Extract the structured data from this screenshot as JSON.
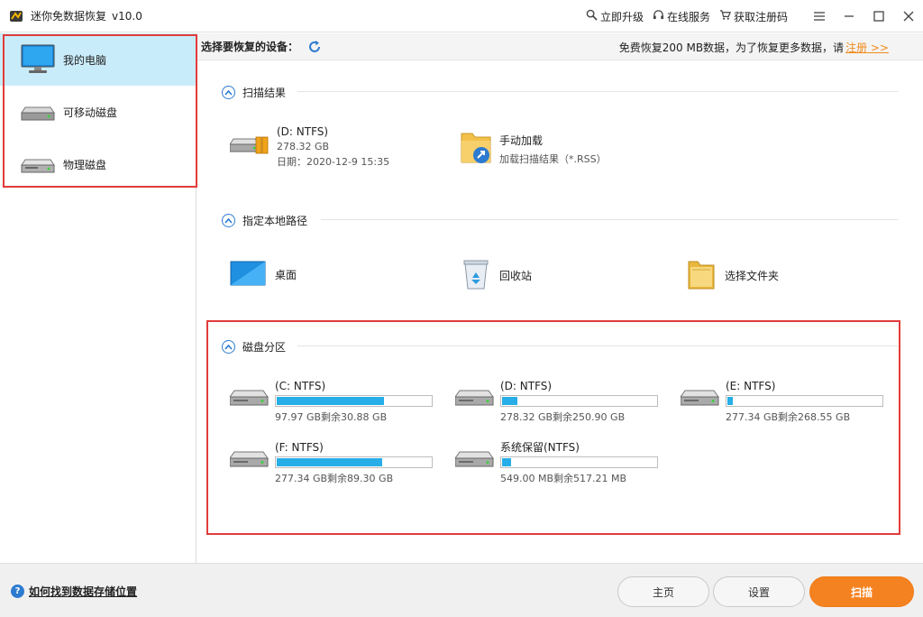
{
  "window": {
    "title": "迷你免数据恢复",
    "version": "v10.0",
    "links": [
      {
        "icon": "magnifier-icon",
        "label": "立即升级"
      },
      {
        "icon": "headset-icon",
        "label": "在线服务"
      },
      {
        "icon": "cart-icon",
        "label": "获取注册码"
      }
    ]
  },
  "sidebar": {
    "items": [
      {
        "icon": "monitor-icon",
        "label": "我的电脑",
        "active": true
      },
      {
        "icon": "removable-disk-icon",
        "label": "可移动磁盘",
        "active": false
      },
      {
        "icon": "physical-disk-icon",
        "label": "物理磁盘",
        "active": false
      }
    ]
  },
  "header": {
    "choose_label": "选择要恢复的设备：",
    "free_note": "免费恢复200 MB数据，为了恢复更多数据，请",
    "register_link": "注册 >>"
  },
  "scan_results": {
    "title": "扫描结果",
    "last_scan": {
      "name": "(D: NTFS)",
      "size": "278.32 GB",
      "date": "日期：2020-12-9 15:35"
    },
    "manual_load": {
      "title": "手动加载",
      "subtitle": "加载扫描结果（*.RSS）"
    }
  },
  "local_path": {
    "title": "指定本地路径",
    "items": [
      {
        "icon": "desktop-icon",
        "label": "桌面"
      },
      {
        "icon": "recycle-bin-icon",
        "label": "回收站"
      },
      {
        "icon": "folder-icon",
        "label": "选择文件夹"
      }
    ]
  },
  "partitions": {
    "title": "磁盘分区",
    "items": [
      {
        "name": "(C: NTFS)",
        "size": "97.97 GB剩余30.88 GB",
        "used_fraction": 0.685
      },
      {
        "name": "(D: NTFS)",
        "size": "278.32 GB剩余250.90 GB",
        "used_fraction": 0.099
      },
      {
        "name": "(E: NTFS)",
        "size": "277.34 GB剩余268.55 GB",
        "used_fraction": 0.032
      },
      {
        "name": "(F: NTFS)",
        "size": "277.34 GB剩余89.30 GB",
        "used_fraction": 0.678
      },
      {
        "name": "系统保留(NTFS)",
        "size": "549.00 MB剩余517.21 MB",
        "used_fraction": 0.058
      }
    ]
  },
  "footer": {
    "help": "如何找到数据存储位置",
    "home": "主页",
    "settings": "设置",
    "scan": "扫描"
  },
  "colors": {
    "accent": "#f58220",
    "active_bg": "#c9ecfb",
    "bar_fill": "#27aee8",
    "highlight_border": "#e23b3b",
    "link_orange": "#f08a1a"
  }
}
